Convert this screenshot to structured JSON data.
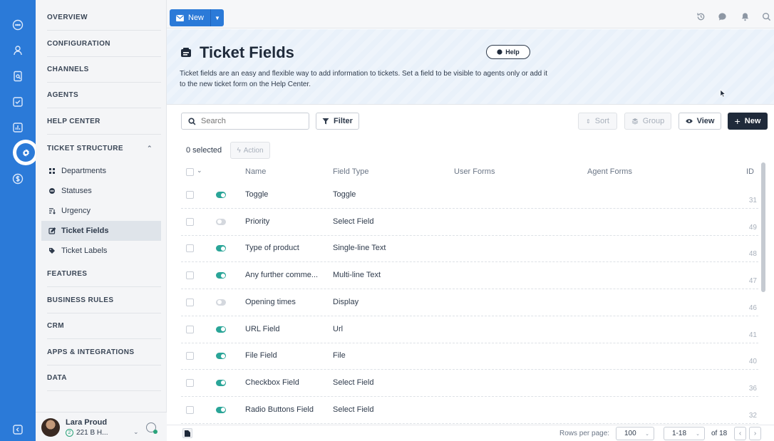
{
  "nav": {
    "sections": [
      {
        "key": "overview",
        "label": "OVERVIEW"
      },
      {
        "key": "configuration",
        "label": "CONFIGURATION"
      },
      {
        "key": "channels",
        "label": "CHANNELS"
      },
      {
        "key": "agents",
        "label": "AGENTS"
      },
      {
        "key": "help-center",
        "label": "HELP CENTER"
      },
      {
        "key": "ticket-structure",
        "label": "TICKET STRUCTURE"
      },
      {
        "key": "features",
        "label": "FEATURES"
      },
      {
        "key": "business-rules",
        "label": "BUSINESS RULES"
      },
      {
        "key": "crm",
        "label": "CRM"
      },
      {
        "key": "apps-integrations",
        "label": "APPS & INTEGRATIONS"
      },
      {
        "key": "data",
        "label": "DATA"
      }
    ],
    "sub_items": [
      {
        "label": "Departments",
        "icon": "departments-icon"
      },
      {
        "label": "Statuses",
        "icon": "statuses-icon"
      },
      {
        "label": "Urgency",
        "icon": "urgency-icon"
      },
      {
        "label": "Ticket Fields",
        "icon": "edit-icon",
        "active": true
      },
      {
        "label": "Ticket Labels",
        "icon": "tag-icon"
      }
    ],
    "user": {
      "name": "Lara Proud",
      "count": "2",
      "location": "221 B H..."
    }
  },
  "topbar": {
    "new_label": "New"
  },
  "header": {
    "title": "Ticket Fields",
    "help_label": "Help",
    "description": "Ticket fields are an easy and flexible way to add information to tickets. Set a field to be visible to agents only or add it to the new ticket form on the Help Center."
  },
  "toolbar": {
    "search_placeholder": "Search",
    "filter_label": "Filter",
    "sort_label": "Sort",
    "group_label": "Group",
    "view_label": "View",
    "new_label": "New"
  },
  "selection": {
    "selected_text": "0 selected",
    "action_label": "Action"
  },
  "table": {
    "columns": {
      "name": "Name",
      "field_type": "Field Type",
      "user_forms": "User Forms",
      "agent_forms": "Agent Forms",
      "id": "ID"
    },
    "rows": [
      {
        "name": "Toggle",
        "type": "Toggle",
        "id": "31",
        "enabled": true
      },
      {
        "name": "Priority",
        "type": "Select Field",
        "id": "49",
        "enabled": false
      },
      {
        "name": "Type of product",
        "type": "Single-line Text",
        "id": "48",
        "enabled": true
      },
      {
        "name": "Any further comme...",
        "type": "Multi-line Text",
        "id": "47",
        "enabled": true
      },
      {
        "name": "Opening times",
        "type": "Display",
        "id": "46",
        "enabled": false
      },
      {
        "name": "URL Field",
        "type": "Url",
        "id": "41",
        "enabled": true
      },
      {
        "name": "File Field",
        "type": "File",
        "id": "40",
        "enabled": true
      },
      {
        "name": "Checkbox Field",
        "type": "Select Field",
        "id": "36",
        "enabled": true
      },
      {
        "name": "Radio Buttons Field",
        "type": "Select Field",
        "id": "32",
        "enabled": true
      }
    ]
  },
  "footer": {
    "rows_per_page_label": "Rows per page:",
    "rows_per_page": "100",
    "range": "1-18",
    "of_total": "of 18"
  },
  "colors": {
    "rail": "#2b7ad8",
    "toggle_on": "#2aa598",
    "toggle_off": "#d4d8de",
    "dark_button": "#1f2a3a"
  }
}
